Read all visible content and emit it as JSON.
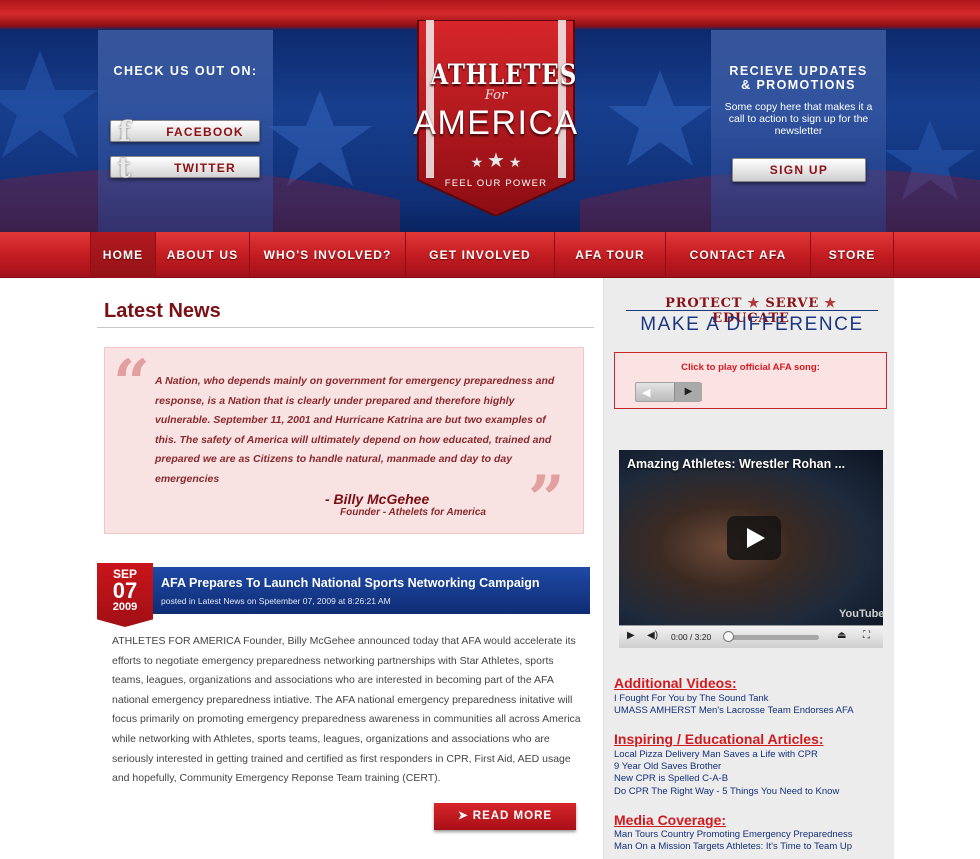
{
  "header": {
    "left_title": "CHECK US OUT ON:",
    "facebook_label": "FACEBOOK",
    "twitter_label": "TWITTER",
    "logo_line1": "ATHLETES",
    "logo_for": "For",
    "logo_line2": "AMERICA",
    "tagline": "FEEL OUR POWER",
    "right_title_1": "RECIEVE UPDATES",
    "right_title_2": "& PROMOTIONS",
    "right_copy": "Some copy here that makes it a call to action to sign up for the newsletter",
    "signup_label": "SIGN UP"
  },
  "nav": {
    "items": [
      "HOME",
      "ABOUT US",
      "WHO'S INVOLVED?",
      "GET INVOLVED",
      "AFA TOUR",
      "CONTACT AFA",
      "STORE"
    ]
  },
  "main": {
    "title": "Latest News",
    "quote": {
      "text": "A Nation, who depends mainly on government for emergency preparedness and response, is a Nation that is clearly under prepared and therefore highly vulnerable. September 11, 2001 and Hurricane Katrina are but two examples of this. The safety of America will ultimately depend on how educated, trained and prepared we are as Citizens to handle natural, manmade and day to day emergencies",
      "author": "- Billy McGehee",
      "role": "Founder - Athelets for America"
    },
    "article": {
      "month": "SEP",
      "day": "07",
      "year": "2009",
      "title": "AFA Prepares To Launch National Sports Networking Campaign",
      "meta": "posted in Latest News on Spetember 07, 2009 at 8:26:21 AM",
      "body": "ATHLETES FOR AMERICA Founder, Billy McGehee announced today that AFA would accelerate its efforts to negotiate emergency preparedness networking partnerships with Star Athletes, sports teams, leagues, organizations and associations who are interested in becoming part of the AFA national emergency preparedness intiative. The AFA national emergency preparedness initative will focus primarily on promoting emergency preparedness awareness in communities all across America while networking with Athletes, sports teams, leagues, organizations and associations who are seriously interested in getting trained and certified as first responders in CPR, First Aid, AED usage and hopefully, Community Emergency Reponse Team training (CERT).",
      "read_more": "READ MORE"
    }
  },
  "sidebar": {
    "motto_words": [
      "PROTECT",
      "SERVE",
      "EDUCATE"
    ],
    "motto_bottom": "MAKE A DIFFERENCE",
    "song_label": "Click to play official AFA song:",
    "video": {
      "title": "Amazing Athletes: Wrestler Rohan ...",
      "time": "0:00 / 3:20",
      "brand": "YouTube"
    },
    "sections": [
      {
        "heading": "Additional Videos:",
        "links": [
          "I Fought For You by The Sound Tank",
          "UMASS AMHERST Men's Lacrosse Team Endorses AFA"
        ]
      },
      {
        "heading": "Inspiring / Educational Articles:",
        "links": [
          "Local Pizza Delivery Man Saves a Life with CPR",
          "9 Year Old Saves Brother",
          "New CPR is Spelled C-A-B",
          "Do CPR The Right Way - 5 Things You Need to Know"
        ]
      },
      {
        "heading": "Media Coverage:",
        "links": [
          "Man Tours Country Promoting Emergency Preparedness",
          "Man On a Mission Targets Athletes: It's Time to Team Up"
        ]
      }
    ]
  },
  "colors": {
    "brand_red": "#c41d22",
    "brand_blue": "#173f8e",
    "dark_red": "#7a1015",
    "link_blue": "#15307a"
  }
}
